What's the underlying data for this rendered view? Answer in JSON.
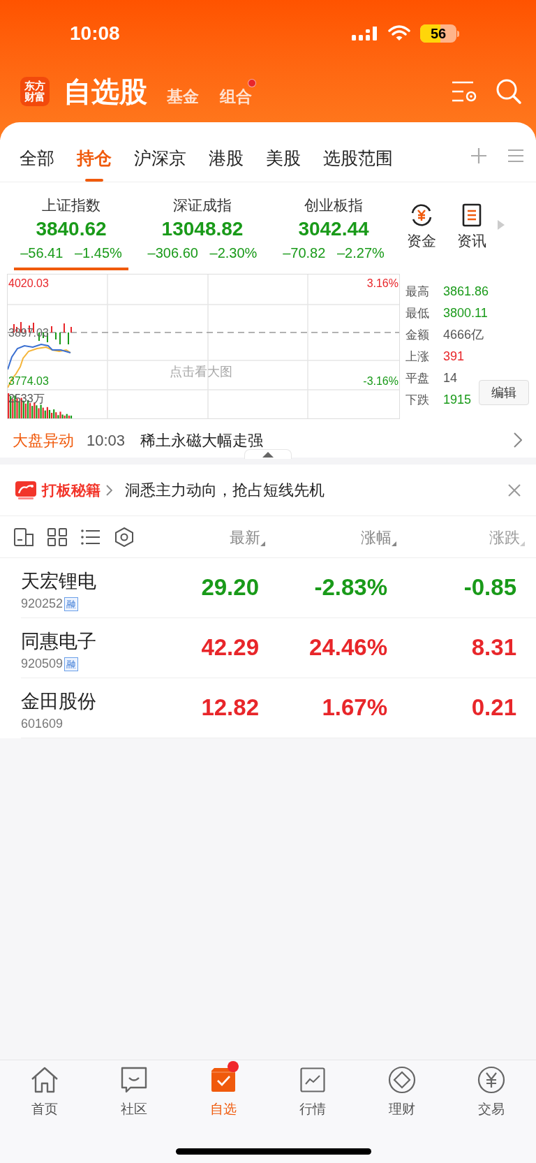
{
  "status_bar": {
    "time": "10:08",
    "battery": "56"
  },
  "header": {
    "logo_lines": [
      "东方",
      "财富"
    ],
    "tabs": [
      {
        "label": "自选股",
        "selected": true,
        "badge": false
      },
      {
        "label": "基金",
        "selected": false,
        "badge": false
      },
      {
        "label": "组合",
        "selected": false,
        "badge": true
      }
    ]
  },
  "category_tabs": [
    {
      "label": "全部",
      "selected": false
    },
    {
      "label": "持仓",
      "selected": true
    },
    {
      "label": "沪深京",
      "selected": false
    },
    {
      "label": "港股",
      "selected": false
    },
    {
      "label": "美股",
      "selected": false
    },
    {
      "label": "选股范围",
      "selected": false
    }
  ],
  "indices": [
    {
      "name": "上证指数",
      "value": "3840.62",
      "change": "–56.41",
      "percent": "–1.45%",
      "color": "#199a19",
      "selected": true
    },
    {
      "name": "深证成指",
      "value": "13048.82",
      "change": "–306.60",
      "percent": "–2.30%",
      "color": "#199a19",
      "selected": false
    },
    {
      "name": "创业板指",
      "value": "3042.44",
      "change": "–70.82",
      "percent": "–2.27%",
      "color": "#199a19",
      "selected": false
    }
  ],
  "index_shortcuts": [
    {
      "label": "资金",
      "kind": "fund"
    },
    {
      "label": "资讯",
      "kind": "news"
    }
  ],
  "chart": {
    "high_label": "4020.03",
    "high_pct": "3.16%",
    "mid_label": "3897.03",
    "low_label": "3774.03",
    "low_pct": "-3.16%",
    "volume_label": "2533万",
    "hint": "点击看大图"
  },
  "market_stats": [
    {
      "label": "最高",
      "value": "3861.86",
      "color": "#199a19"
    },
    {
      "label": "最低",
      "value": "3800.11",
      "color": "#199a19"
    },
    {
      "label": "金额",
      "value": "4666亿",
      "color": "#555555"
    },
    {
      "label": "上涨",
      "value": "391",
      "color": "#e8262a"
    },
    {
      "label": "平盘",
      "value": "14",
      "color": "#555555"
    },
    {
      "label": "下跌",
      "value": "1915",
      "color": "#199a19"
    }
  ],
  "edit_button": "编辑",
  "alert": {
    "tag": "大盘异动",
    "time": "10:03",
    "headline": "稀土永磁大幅走强"
  },
  "promo": {
    "title": "打板秘籍",
    "text": "洞悉主力动向，抢占短线先机"
  },
  "list_header": {
    "columns": [
      "最新",
      "涨幅",
      "涨跌"
    ]
  },
  "stocks": [
    {
      "name": "天宏锂电",
      "code": "920252",
      "margin": true,
      "color": "#199a19",
      "price": "29.20",
      "percent": "-2.83%",
      "change": "-0.85"
    },
    {
      "name": "同惠电子",
      "code": "920509",
      "margin": true,
      "color": "#e8262a",
      "price": "42.29",
      "percent": "24.46%",
      "change": "8.31"
    },
    {
      "name": "金田股份",
      "code": "601609",
      "margin": false,
      "color": "#e8262a",
      "price": "12.82",
      "percent": "1.67%",
      "change": "0.21"
    }
  ],
  "bottom_nav": [
    {
      "label": "首页",
      "kind": "home",
      "selected": false,
      "badge": false
    },
    {
      "label": "社区",
      "kind": "community",
      "selected": false,
      "badge": false
    },
    {
      "label": "自选",
      "kind": "watchlist",
      "selected": true,
      "badge": true
    },
    {
      "label": "行情",
      "kind": "market",
      "selected": false,
      "badge": false
    },
    {
      "label": "理财",
      "kind": "wealth",
      "selected": false,
      "badge": false
    },
    {
      "label": "交易",
      "kind": "trade",
      "selected": false,
      "badge": false
    }
  ]
}
